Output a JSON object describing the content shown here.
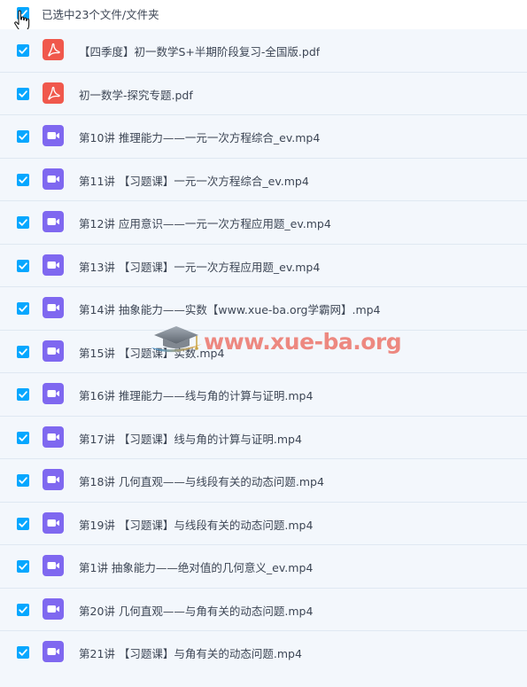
{
  "header": {
    "selection_label": "已选中23个文件/文件夹"
  },
  "files": [
    {
      "name": "【四季度】初一数学S+半期阶段复习-全国版.pdf",
      "type": "pdf"
    },
    {
      "name": "初一数学-探究专题.pdf",
      "type": "pdf"
    },
    {
      "name": "第10讲 推理能力——一元一次方程综合_ev.mp4",
      "type": "video"
    },
    {
      "name": "第11讲 【习题课】一元一次方程综合_ev.mp4",
      "type": "video"
    },
    {
      "name": "第12讲 应用意识——一元一次方程应用题_ev.mp4",
      "type": "video"
    },
    {
      "name": "第13讲 【习题课】一元一次方程应用题_ev.mp4",
      "type": "video"
    },
    {
      "name": "第14讲 抽象能力——实数【www.xue-ba.org学霸网】.mp4",
      "type": "video"
    },
    {
      "name": "第15讲 【习题课】实数.mp4",
      "type": "video"
    },
    {
      "name": "第16讲 推理能力——线与角的计算与证明.mp4",
      "type": "video"
    },
    {
      "name": "第17讲 【习题课】线与角的计算与证明.mp4",
      "type": "video"
    },
    {
      "name": "第18讲 几何直观——与线段有关的动态问题.mp4",
      "type": "video"
    },
    {
      "name": "第19讲 【习题课】与线段有关的动态问题.mp4",
      "type": "video"
    },
    {
      "name": "第1讲 抽象能力——绝对值的几何意义_ev.mp4",
      "type": "video"
    },
    {
      "name": "第20讲 几何直观——与角有关的动态问题.mp4",
      "type": "video"
    },
    {
      "name": "第21讲 【习题课】与角有关的动态问题.mp4",
      "type": "video"
    }
  ],
  "watermark": {
    "text": "www.xue-ba.org"
  },
  "colors": {
    "checkbox": "#06a7ff",
    "pdf_icon": "#f0584c",
    "video_icon": "#7f68f0",
    "row_bg": "#f3f7fc",
    "text": "#3d4655"
  },
  "icons": {
    "pdf": "pdf-file-icon",
    "video": "video-file-icon",
    "checkbox": "checkbox-checked-icon",
    "cursor": "hand-pointer-cursor-icon"
  }
}
